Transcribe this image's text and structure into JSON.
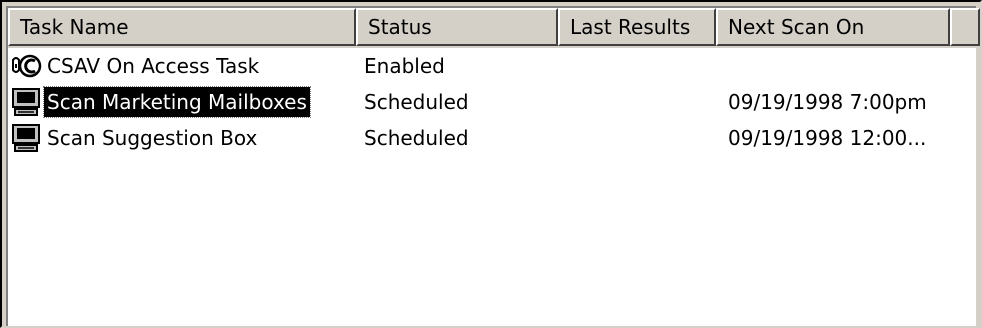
{
  "columns": {
    "task_name": "Task Name",
    "status": "Status",
    "last_results": "Last Results",
    "next_scan_on": "Next Scan On"
  },
  "rows": [
    {
      "icon": "on-access-shield-icon",
      "name": "CSAV On Access Task",
      "status": "Enabled",
      "last_results": "",
      "next_scan_on": ""
    },
    {
      "icon": "computer-icon",
      "name": "Scan Marketing Mailboxes",
      "status": "Scheduled",
      "last_results": "",
      "next_scan_on": "09/19/1998 7:00pm",
      "selected": true
    },
    {
      "icon": "computer-icon",
      "name": "Scan Suggestion Box",
      "status": "Scheduled",
      "last_results": "",
      "next_scan_on": "09/19/1998 12:00..."
    }
  ],
  "colors": {
    "selection_bg": "#000000",
    "selection_text": "#ffffff",
    "header_bg": "#d4d0c8"
  }
}
